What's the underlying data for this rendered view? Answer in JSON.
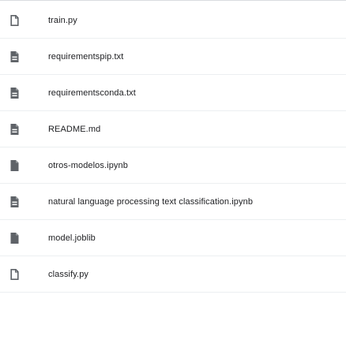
{
  "files": [
    {
      "name": "train.py",
      "icon": "file-outline-icon"
    },
    {
      "name": "requirementspip.txt",
      "icon": "file-lines-icon"
    },
    {
      "name": "requirementsconda.txt",
      "icon": "file-lines-icon"
    },
    {
      "name": "README.md",
      "icon": "file-lines-icon"
    },
    {
      "name": "otros-modelos.ipynb",
      "icon": "file-filled-icon"
    },
    {
      "name": "natural language processing text classification.ipynb",
      "icon": "file-lines-icon"
    },
    {
      "name": "model.joblib",
      "icon": "file-filled-icon"
    },
    {
      "name": "classify.py",
      "icon": "file-outline-icon"
    }
  ],
  "colors": {
    "icon": "#5f6368",
    "text": "#202124",
    "divider": "#eceff1"
  }
}
